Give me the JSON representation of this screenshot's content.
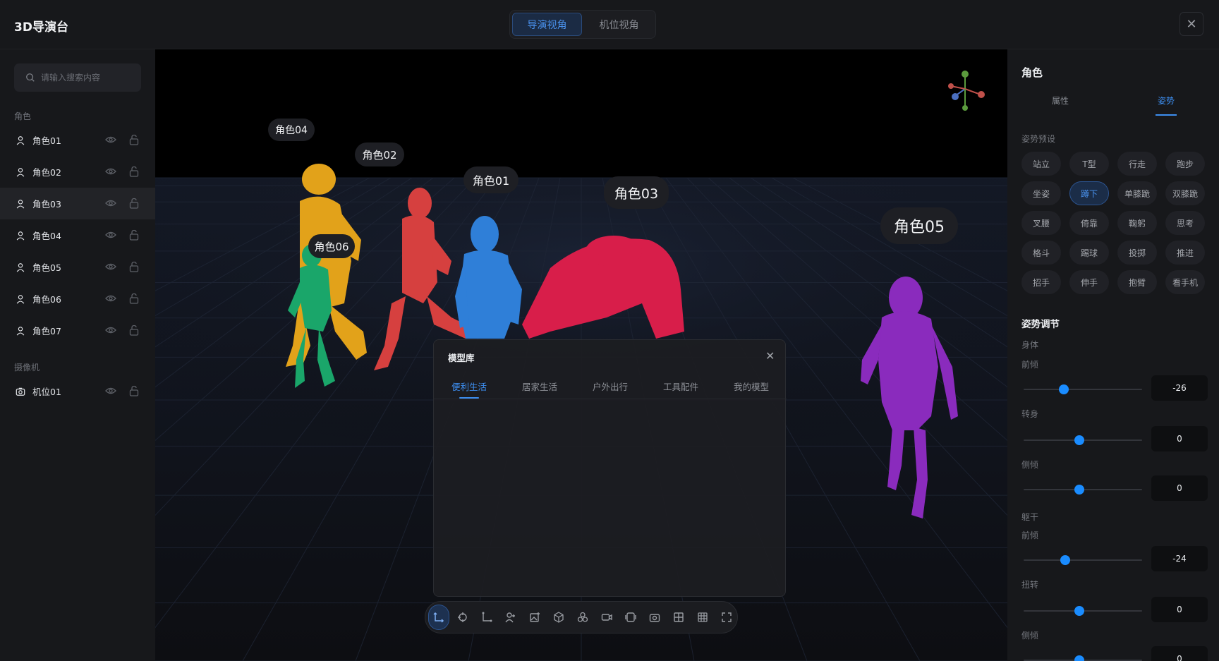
{
  "app": {
    "title": "3D导演台"
  },
  "view_switch": {
    "director": "导演视角",
    "camera": "机位视角"
  },
  "sidebar": {
    "search_placeholder": "请输入搜索内容",
    "roles_label": "角色",
    "roles": [
      {
        "label": "角色01"
      },
      {
        "label": "角色02"
      },
      {
        "label": "角色03"
      },
      {
        "label": "角色04"
      },
      {
        "label": "角色05"
      },
      {
        "label": "角色06"
      },
      {
        "label": "角色07"
      }
    ],
    "selected_index": 2,
    "camera_label": "摄像机",
    "cameras": [
      {
        "label": "机位01"
      }
    ]
  },
  "scene": {
    "tags": {
      "c04": "角色04",
      "c02": "角色02",
      "c01": "角色01",
      "c03": "角色03",
      "c06": "角色06",
      "c05": "角色05"
    },
    "colors": {
      "c04": "#e2a21a",
      "c02": "#d6403f",
      "c01": "#2f7fd8",
      "c03": "#d81e4a",
      "c06": "#1aa66a",
      "c05": "#8a2bbd"
    }
  },
  "model_library": {
    "title": "模型库",
    "tabs": [
      "便利生活",
      "居家生活",
      "户外出行",
      "工具配件",
      "我的模型"
    ],
    "active_tab": 0
  },
  "toolbar": {
    "tools": [
      "axis-move-icon",
      "rotate-icon",
      "scale-icon",
      "add-person-icon",
      "add-image-icon",
      "cube-icon",
      "group-icon",
      "camera-video-icon",
      "layers-icon",
      "photo-camera-icon",
      "grid-icon",
      "table-icon",
      "fullscreen-icon"
    ]
  },
  "right_panel": {
    "title": "角色",
    "tabs": [
      "属性",
      "姿势"
    ],
    "active_tab": 1,
    "preset_label": "姿势预设",
    "presets": [
      "站立",
      "T型",
      "行走",
      "跑步",
      "坐姿",
      "蹲下",
      "单膝跪",
      "双膝跪",
      "叉腰",
      "倚靠",
      "鞠躬",
      "思考",
      "格斗",
      "踢球",
      "投掷",
      "推进",
      "招手",
      "伸手",
      "抱臂",
      "看手机"
    ],
    "active_preset": 5,
    "adjust_label": "姿势调节",
    "body_label": "身体",
    "torso_label": "躯干",
    "sliders": {
      "body_lean": {
        "label": "前倾",
        "value": "-26",
        "fraction": 0.34
      },
      "body_turn": {
        "label": "转身",
        "value": "0",
        "fraction": 0.47
      },
      "body_tilt": {
        "label": "侧倾",
        "value": "0",
        "fraction": 0.47
      },
      "torso_lean": {
        "label": "前倾",
        "value": "-24",
        "fraction": 0.35
      },
      "torso_twist": {
        "label": "扭转",
        "value": "0",
        "fraction": 0.47
      },
      "torso_tilt": {
        "label": "侧倾",
        "value": "0",
        "fraction": 0.47
      }
    }
  }
}
